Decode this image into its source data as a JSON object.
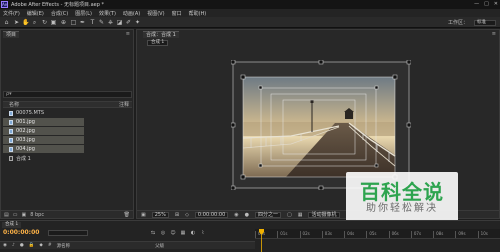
{
  "window": {
    "title": "Adobe After Effects - 无标题项目.aep *",
    "app_icon_text": "Ae",
    "controls": [
      "—",
      "□",
      "✕"
    ]
  },
  "menu": [
    "文件(F)",
    "编辑(E)",
    "合成(C)",
    "图层(L)",
    "效果(T)",
    "动画(A)",
    "视图(V)",
    "窗口",
    "帮助(H)"
  ],
  "toolbar": {
    "workspace_label": "工作区：",
    "workspace_value": "标准"
  },
  "project": {
    "tab_label": "项目",
    "search_placeholder": "ρ▾",
    "columns": {
      "name": "名称",
      "note": "注释"
    },
    "items": [
      {
        "name": "00075.MTS",
        "kind": "footage",
        "selected": false
      },
      {
        "name": "001.jpg",
        "kind": "footage",
        "selected": true
      },
      {
        "name": "002.jpg",
        "kind": "footage",
        "selected": true
      },
      {
        "name": "003.jpg",
        "kind": "footage",
        "selected": true
      },
      {
        "name": "004.jpg",
        "kind": "footage",
        "selected": true
      },
      {
        "name": "合成 1",
        "kind": "composition",
        "selected": false
      }
    ],
    "footer": {
      "bpc": "8 bpc"
    }
  },
  "composition": {
    "tab_label": "合成：合成 1",
    "breadcrumb": "合成 1",
    "zoom": "25%",
    "timecode": "0:00:00:00",
    "resolution": "四分之一",
    "camera": "活动摄像机"
  },
  "watermark": {
    "main": "百科全说",
    "sub": "助你轻松解决"
  },
  "timeline": {
    "tab_label": "合成 1",
    "timecode": "0:00:00:00",
    "header_col": "源名称",
    "parent_col": "父级",
    "ruler_ticks": [
      "00s",
      "01s",
      "02s",
      "03s",
      "04s",
      "05s",
      "06s",
      "07s",
      "08s",
      "09s",
      "10s"
    ]
  }
}
